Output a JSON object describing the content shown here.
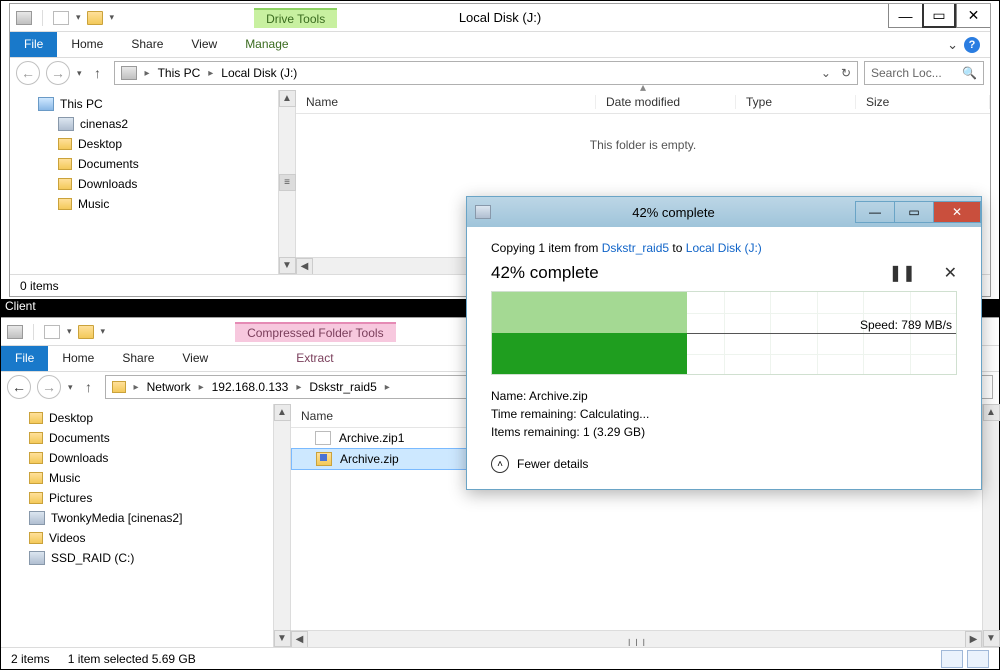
{
  "win1": {
    "ctx_tab": "Drive Tools",
    "title": "Local Disk (J:)",
    "ribbon": {
      "file": "File",
      "home": "Home",
      "share": "Share",
      "view": "View",
      "manage": "Manage"
    },
    "breadcrumbs": [
      "This PC",
      "Local Disk (J:)"
    ],
    "search_placeholder": "Search Loc...",
    "columns": {
      "name": "Name",
      "date": "Date modified",
      "type": "Type",
      "size": "Size"
    },
    "empty_msg": "This folder is empty.",
    "nav": {
      "root": "This PC",
      "children": [
        "cinenas2",
        "Desktop",
        "Documents",
        "Downloads",
        "Music"
      ]
    },
    "status": "0 items"
  },
  "client_label": "Client",
  "win2": {
    "ctx_tab": "Compressed Folder Tools",
    "ribbon": {
      "file": "File",
      "home": "Home",
      "share": "Share",
      "view": "View",
      "extract": "Extract"
    },
    "breadcrumbs": [
      "Network",
      "192.168.0.133",
      "Dskstr_raid5"
    ],
    "columns": {
      "name": "Name"
    },
    "nav": [
      "Desktop",
      "Documents",
      "Downloads",
      "Music",
      "Pictures",
      "TwonkyMedia [cinenas2]",
      "Videos",
      "SSD_RAID (C:)"
    ],
    "files": [
      {
        "name": "Archive.zip1",
        "kind": "file"
      },
      {
        "name": "Archive.zip",
        "kind": "zip",
        "selected": true
      }
    ],
    "status_items": "2 items",
    "status_sel": "1 item selected  5.69 GB"
  },
  "dlg": {
    "title": "42% complete",
    "copy_prefix": "Copying 1 item from ",
    "copy_src": "Dskstr_raid5",
    "copy_mid": " to ",
    "copy_dst": "Local Disk (J:)",
    "pct_header": "42% complete",
    "speed": "Speed: 789 MB/s",
    "name_line": "Name:  Archive.zip",
    "time_line": "Time remaining:  Calculating...",
    "items_line": "Items remaining:  1 (3.29 GB)",
    "fewer": "Fewer details",
    "progress_fraction": 0.42
  }
}
